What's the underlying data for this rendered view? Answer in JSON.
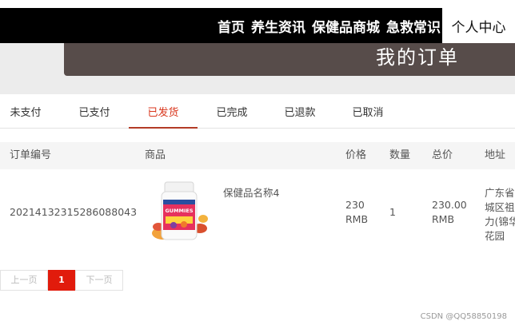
{
  "nav": {
    "items": [
      "首页",
      "养生资讯",
      "保健品商城",
      "急救常识"
    ],
    "active": "个人中心"
  },
  "header": {
    "title": "我的订单"
  },
  "tabs": [
    {
      "label": "未支付",
      "active": false
    },
    {
      "label": "已支付",
      "active": false
    },
    {
      "label": "已发货",
      "active": true
    },
    {
      "label": "已完成",
      "active": false
    },
    {
      "label": "已退款",
      "active": false
    },
    {
      "label": "已取消",
      "active": false
    }
  ],
  "table": {
    "columns": [
      "订单编号",
      "商品",
      "价格",
      "数量",
      "总价",
      "地址"
    ],
    "rows": [
      {
        "order_no": "20214132315286088043",
        "product_name": "保健品名称4",
        "product_image_text": "GUMMIES",
        "price_line1": "230",
        "price_line2": "RMB",
        "quantity": "1",
        "total_line1": "230.00",
        "total_line2": "RMB",
        "address_line1": "广东省",
        "address_line2": "城区祖",
        "address_line3": "力(锦华",
        "address_line4": "花园"
      }
    ]
  },
  "pager": {
    "prev": "上一页",
    "current": "1",
    "next": "下一页"
  },
  "watermark": "CSDN @QQ58850198",
  "colors": {
    "accent": "#e11b0c",
    "tab_active": "#d9361c",
    "header_bg": "#000000",
    "title_box": "#574c4a"
  }
}
